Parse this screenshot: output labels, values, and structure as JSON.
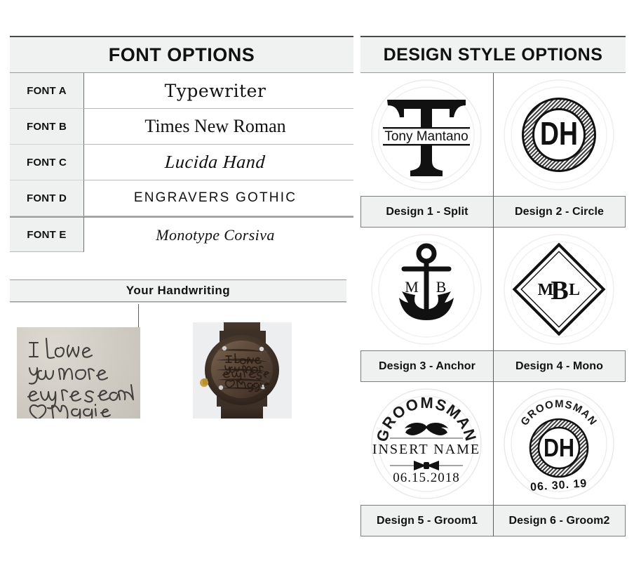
{
  "font_panel": {
    "header": "FONT OPTIONS",
    "rows": [
      {
        "label": "FONT A",
        "sample": "Typewriter"
      },
      {
        "label": "FONT B",
        "sample": "Times New Roman"
      },
      {
        "label": "FONT C",
        "sample": "Lucida Hand"
      },
      {
        "label": "FONT D",
        "sample": "Engravers Gothic"
      },
      {
        "label": "FONT E",
        "sample": "Monotype Corsiva"
      }
    ]
  },
  "handwriting_panel": {
    "header": "Your Handwriting",
    "note_lines": [
      "I Love",
      "you more",
      "every second",
      "♡ Maggie"
    ],
    "watch_lines": [
      "I Love",
      "you more",
      "every second",
      "♡ Maggie"
    ]
  },
  "design_panel": {
    "header": "DESIGN STYLE OPTIONS",
    "designs": [
      {
        "label": "Design 1 - Split",
        "art": {
          "kind": "split",
          "letter": "T",
          "name": "Tony Mantano"
        }
      },
      {
        "label": "Design 2 - Circle",
        "art": {
          "kind": "circle",
          "monogram": "DH"
        }
      },
      {
        "label": "Design 3 - Anchor",
        "art": {
          "kind": "anchor",
          "left_initial": "M",
          "right_initial": "B"
        }
      },
      {
        "label": "Design 4 - Mono",
        "art": {
          "kind": "mono",
          "initials": [
            "M",
            "B",
            "L"
          ]
        }
      },
      {
        "label": "Design 5 - Groom1",
        "art": {
          "kind": "groom1",
          "top": "GROOMSMAN",
          "middle": "INSERT NAME",
          "date": "06.15.2018"
        }
      },
      {
        "label": "Design 6 - Groom2",
        "art": {
          "kind": "groom2",
          "top": "GROOMSMAN",
          "monogram": "DH",
          "date": "06. 30. 19"
        }
      }
    ]
  },
  "colors": {
    "header_bg": "#f0f1f1",
    "label_bg": "#eff0f0",
    "rule": "#5d5d5d",
    "text": "#111111",
    "paper": "#cfcac1",
    "wood": "#4a3b31"
  }
}
